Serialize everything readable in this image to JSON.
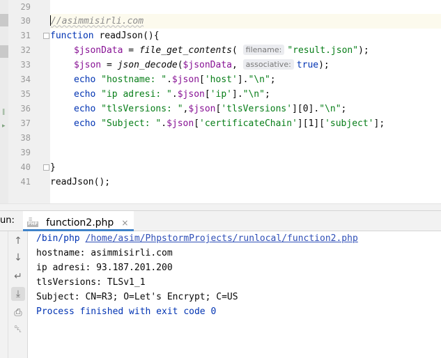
{
  "editor": {
    "line_numbers": [
      "29",
      "30",
      "31",
      "32",
      "33",
      "34",
      "35",
      "36",
      "37",
      "38",
      "39",
      "40",
      "41"
    ],
    "lines": {
      "l30": {
        "comment": "//asimmisirli.com"
      },
      "l31": {
        "keyword": "function",
        "name": " readJson(){"
      },
      "l32": {
        "var": "$jsonData",
        "op": " = ",
        "fn": "file_get_contents",
        "open": "(",
        "hint": "filename:",
        "arg": "\"result.json\"",
        "close": ");"
      },
      "l33": {
        "var": "$json",
        "op": " = ",
        "fn": "json_decode",
        "open": "(",
        "arg_var": "$jsonData",
        "comma": ", ",
        "hint": "associative:",
        "arg": "true",
        "close": ");"
      },
      "l34": {
        "kw": "echo",
        "s1": " \"hostname: \"",
        "dot1": ".",
        "var": "$json",
        "b1": "[",
        "key": "'host'",
        "b2": "]",
        "dot2": ".",
        "s2": "\"\\n\"",
        "end": ";"
      },
      "l35": {
        "kw": "echo",
        "s1": " \"ip adresi: \"",
        "dot1": ".",
        "var": "$json",
        "b1": "[",
        "key": "'ip'",
        "b2": "]",
        "dot2": ".",
        "s2": "\"\\n\"",
        "end": ";"
      },
      "l36": {
        "kw": "echo",
        "s1": " \"tlsVersions: \"",
        "dot1": ",",
        "var": "$json",
        "b1": "[",
        "key": "'tlsVersions'",
        "b2": "][0]",
        "dot2": ".",
        "s2": "\"\\n\"",
        "end": ";"
      },
      "l37": {
        "kw": "echo",
        "s1": " \"Subject: \"",
        "dot1": ".",
        "var": "$json",
        "b1": "[",
        "key": "'certificateChain'",
        "b2": "][1][",
        "key2": "'subject'",
        "b3": "]",
        "end": ";"
      },
      "l40": {
        "text": "}"
      },
      "l41": {
        "text": "readJson();"
      }
    }
  },
  "run": {
    "label": "un:",
    "tab_icon_top": "☰",
    "tab_icon_text": "PHP",
    "tab_label": "function2.php",
    "close_glyph": "×"
  },
  "toolbar_icons": [
    "up-arrow-icon",
    "down-arrow-icon",
    "soft-wrap-icon",
    "scroll-to-end-icon",
    "print-icon",
    "trash-icon"
  ],
  "toolbar_glyphs": {
    "up": "↑",
    "down": "↓",
    "wrap": "↵",
    "scroll_end": "⤓",
    "print": "⎙",
    "trash": "␡"
  },
  "gutter_marks": {
    "a": "‖",
    "b": "▸"
  },
  "console": {
    "cmd_prefix": "/bin/php ",
    "cmd_path": "/home/asim/PhpstormProjects/runlocal/function2.php",
    "out1": "hostname: asimmisirli.com",
    "out2": "ip adresi: 93.187.201.200",
    "out3": "tlsVersions: TLSv1_1",
    "out4": "Subject: CN=R3; O=Let's Encrypt; C=US",
    "exit": "Process finished with exit code 0"
  },
  "colors": {
    "keyword": "#0033b3",
    "variable": "#871094",
    "string": "#067d17",
    "comment": "#8c8c8c",
    "tab_underline": "#4083c9"
  }
}
